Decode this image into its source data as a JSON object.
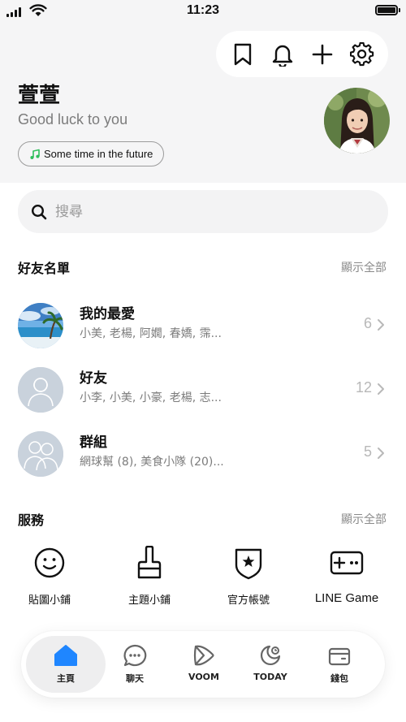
{
  "status_bar": {
    "time": "11:23"
  },
  "toolbar": {
    "icons": [
      "bookmark-icon",
      "bell-icon",
      "plus-icon",
      "gear-icon"
    ]
  },
  "profile": {
    "name": "萱萱",
    "status_message": "Good luck to you",
    "music": "Some time in the future"
  },
  "search": {
    "placeholder": "搜尋"
  },
  "friends_section": {
    "title": "好友名單",
    "show_all": "顯示全部",
    "rows": [
      {
        "title": "我的最愛",
        "subtitle": "小美, 老楊, 阿嫺, 春嬌, 霈...",
        "count": "6"
      },
      {
        "title": "好友",
        "subtitle": "小李, 小美, 小豪, 老楊, 志...",
        "count": "12"
      },
      {
        "title": "群組",
        "subtitle": "網球幫 (8), 美食小隊 (20)...",
        "count": "5"
      }
    ]
  },
  "services_section": {
    "title": "服務",
    "show_all": "顯示全部",
    "items": [
      {
        "label": "貼圖小鋪",
        "icon": "smiley-icon"
      },
      {
        "label": "主題小鋪",
        "icon": "brush-icon"
      },
      {
        "label": "官方帳號",
        "icon": "shield-star-icon"
      },
      {
        "label": "LINE Game",
        "icon": "gamepad-icon"
      }
    ]
  },
  "tab_bar": {
    "tabs": [
      {
        "label": "主頁",
        "icon": "home-icon",
        "active": true
      },
      {
        "label": "聊天",
        "icon": "chat-icon",
        "active": false
      },
      {
        "label": "VOOM",
        "icon": "voom-icon",
        "active": false
      },
      {
        "label": "TODAY",
        "icon": "today-icon",
        "active": false
      },
      {
        "label": "錢包",
        "icon": "wallet-icon",
        "active": false
      }
    ]
  },
  "colors": {
    "accent": "#1f86ff",
    "music_note": "#2fbe5c",
    "muted_text": "#7c7c7c"
  }
}
